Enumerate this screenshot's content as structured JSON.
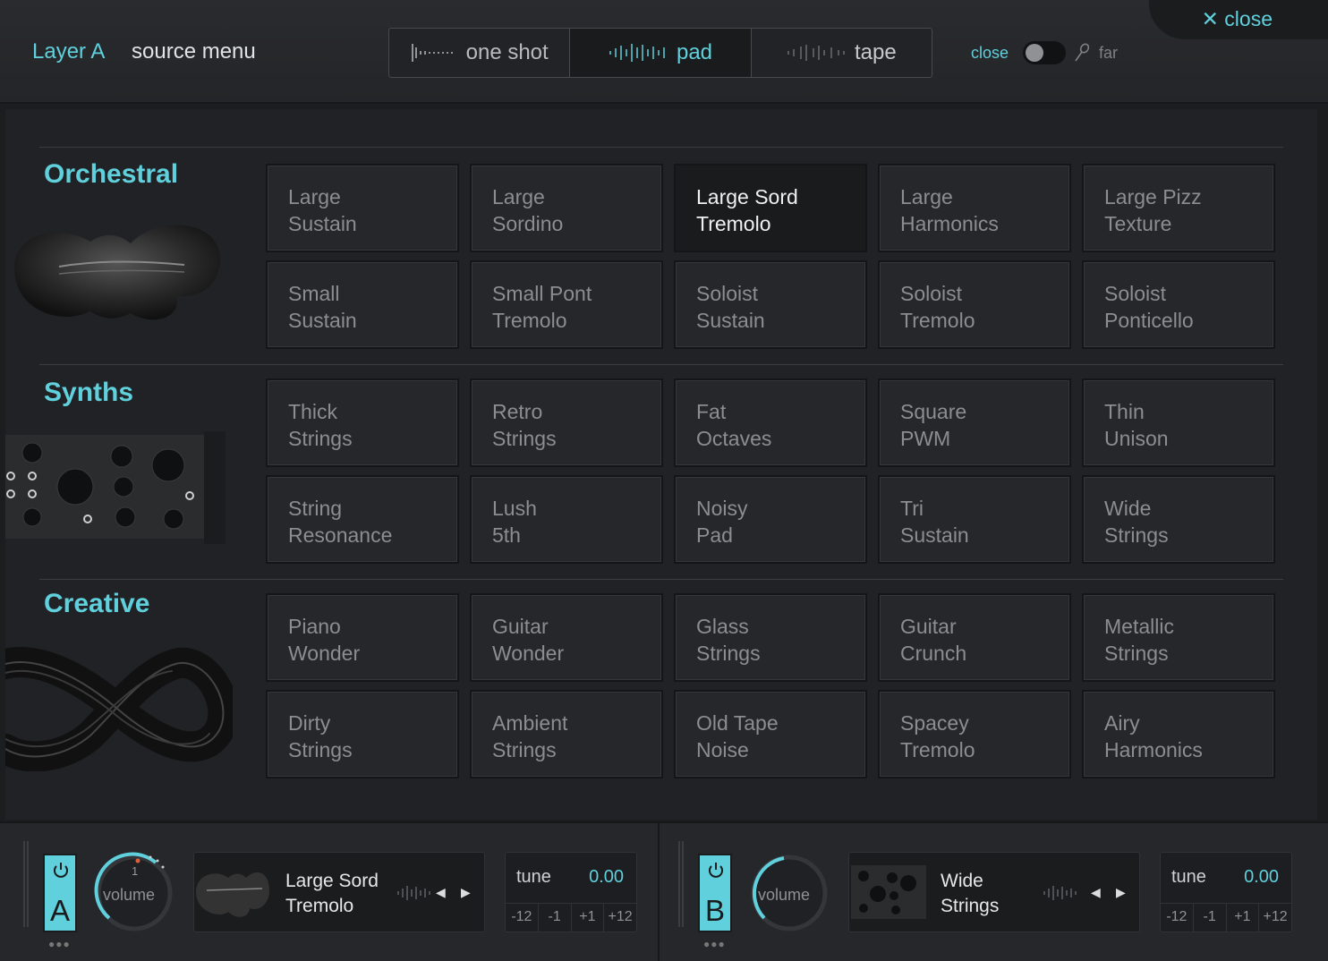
{
  "header": {
    "layer_label": "Layer A",
    "menu_label": "source menu",
    "close_label": "close",
    "modes": [
      {
        "label": "one shot",
        "active": false
      },
      {
        "label": "pad",
        "active": true
      },
      {
        "label": "tape",
        "active": false
      }
    ],
    "distance": {
      "near_label": "close",
      "far_label": "far",
      "toggle_on": false
    }
  },
  "categories": [
    {
      "title": "Orchestral",
      "icon": "cello-image",
      "tiles": [
        [
          "Large",
          "Sustain"
        ],
        [
          "Large",
          "Sordino"
        ],
        [
          "Large Sord",
          "Tremolo"
        ],
        [
          "Large",
          "Harmonics"
        ],
        [
          "Large Pizz",
          "Texture"
        ],
        [
          "Small",
          "Sustain"
        ],
        [
          "Small Pont",
          "Tremolo"
        ],
        [
          "Soloist",
          "Sustain"
        ],
        [
          "Soloist",
          "Tremolo"
        ],
        [
          "Soloist",
          "Ponticello"
        ]
      ]
    },
    {
      "title": "Synths",
      "icon": "synth-module-image",
      "tiles": [
        [
          "Thick",
          "Strings"
        ],
        [
          "Retro",
          "Strings"
        ],
        [
          "Fat",
          "Octaves"
        ],
        [
          "Square",
          "PWM"
        ],
        [
          "Thin",
          "Unison"
        ],
        [
          "String",
          "Resonance"
        ],
        [
          "Lush",
          "5th"
        ],
        [
          "Noisy",
          "Pad"
        ],
        [
          "Tri",
          "Sustain"
        ],
        [
          "Wide",
          "Strings"
        ]
      ]
    },
    {
      "title": "Creative",
      "icon": "infinity-cable-image",
      "tiles": [
        [
          "Piano",
          "Wonder"
        ],
        [
          "Guitar",
          "Wonder"
        ],
        [
          "Glass",
          "Strings"
        ],
        [
          "Guitar",
          "Crunch"
        ],
        [
          "Metallic",
          "Strings"
        ],
        [
          "Dirty",
          "Strings"
        ],
        [
          "Ambient",
          "Strings"
        ],
        [
          "Old Tape",
          "Noise"
        ],
        [
          "Spacey",
          "Tremolo"
        ],
        [
          "Airy",
          "Harmonics"
        ]
      ]
    }
  ],
  "selected_tile": "Large Sord Tremolo",
  "layers": [
    {
      "letter": "A",
      "volume_label": "volume",
      "volume_marker": "1",
      "source_line1": "Large Sord",
      "source_line2": "Tremolo",
      "source_icon": "cello-thumbnail",
      "tune_label": "tune",
      "tune_value": "0.00",
      "tune_steps": [
        "-12",
        "-1",
        "+1",
        "+12"
      ]
    },
    {
      "letter": "B",
      "volume_label": "volume",
      "source_line1": "Wide",
      "source_line2": "Strings",
      "source_icon": "synth-thumbnail",
      "tune_label": "tune",
      "tune_value": "0.00",
      "tune_steps": [
        "-12",
        "-1",
        "+1",
        "+12"
      ]
    }
  ],
  "colors": {
    "accent": "#5fd0dc",
    "background": "#1c1d1f",
    "tile": "#26272a",
    "tile_selected": "#1a1b1d"
  }
}
